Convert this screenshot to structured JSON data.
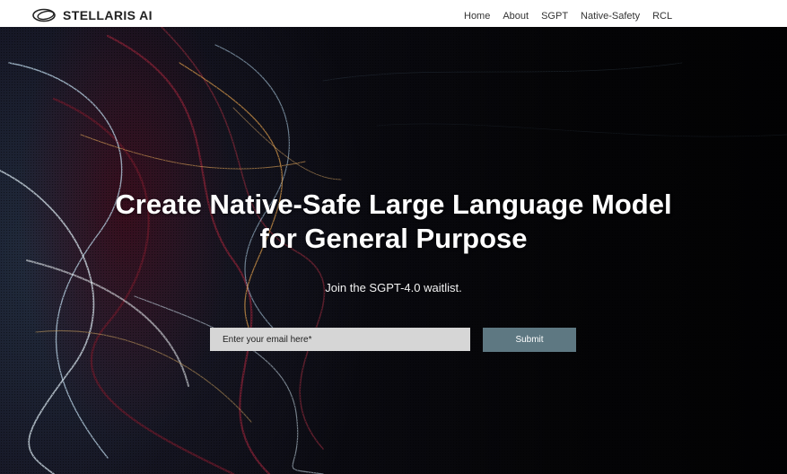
{
  "brand": {
    "name": "STELLARIS AI",
    "logo_icon": "stellaris-orbit-logo"
  },
  "nav": {
    "items": [
      {
        "label": "Home"
      },
      {
        "label": "About"
      },
      {
        "label": "SGPT"
      },
      {
        "label": "Native-Safety"
      },
      {
        "label": "RCL"
      }
    ]
  },
  "hero": {
    "title_line1": "Create Native-Safe Large Language Model",
    "title_line2": "for General Purpose",
    "subtitle": "Join the SGPT-4.0 waitlist."
  },
  "form": {
    "email_placeholder": "Enter your email here*",
    "email_value": "",
    "submit_label": "Submit"
  },
  "colors": {
    "topbar": "#ffffff",
    "submit_button": "#5e7882",
    "input_background": "#d6d6d6",
    "hero_background": "#050507"
  }
}
